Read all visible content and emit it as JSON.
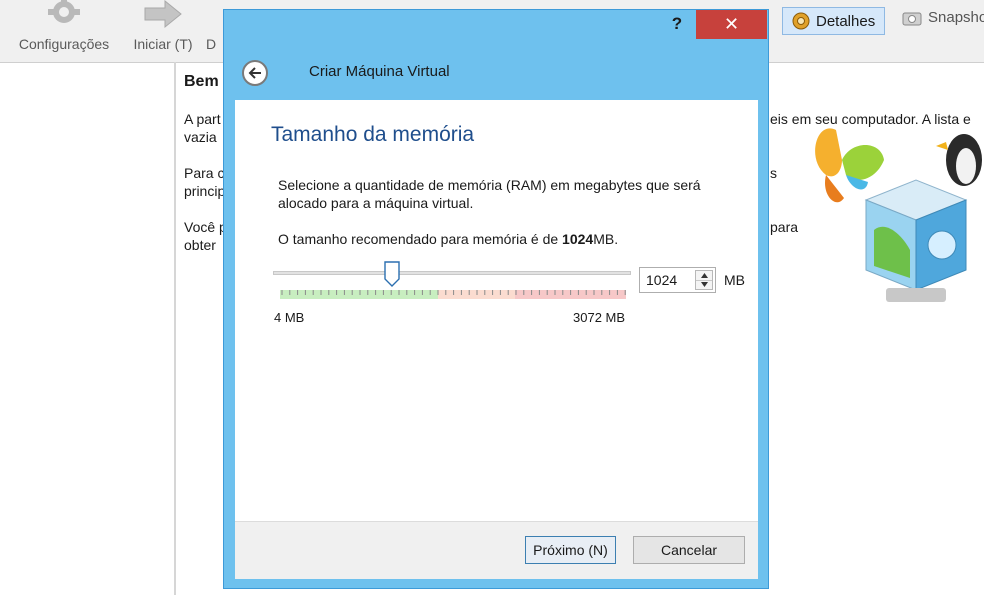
{
  "toolbar": {
    "settings_label": "Configurações",
    "start_label": "Iniciar (T)",
    "third_label": "D",
    "details_label": "Detalhes",
    "snapshot_label": "Snapsho"
  },
  "background": {
    "welcome_title": "Bem",
    "para1_line1_left": "A part",
    "para1_line2_left": "vazia",
    "para1_line1_right": "eis em seu computador. A lista e",
    "para2_line1_left": "Para c",
    "para2_line2_left": "princip",
    "para2_line1_right": "s",
    "para3_line1_left": "Você p",
    "para3_line2_left": "obter",
    "para3_line1_right": "para"
  },
  "dialog": {
    "help_label": "?",
    "close_label": "✕",
    "title": "Criar Máquina Virtual",
    "section_title": "Tamanho da memória",
    "description": "Selecione a quantidade de memória (RAM) em megabytes que será alocado para a máquina virtual.",
    "recommended_prefix": "O tamanho recomendado para memória é de ",
    "recommended_value": "1024",
    "recommended_suffix": "MB.",
    "memory": {
      "value": "1024",
      "unit": "MB",
      "min_label": "4 MB",
      "max_label": "3072 MB",
      "min": 4,
      "max": 3072,
      "current": 1024
    },
    "next_label": "Próximo (N)",
    "cancel_label": "Cancelar"
  },
  "colors": {
    "accent": "#6ec1ee",
    "close": "#c7413c",
    "title_blue": "#1f4e8c",
    "scale_green": "#c8eec0",
    "scale_orange": "#fbdcd0",
    "scale_red": "#f7c8c8"
  }
}
